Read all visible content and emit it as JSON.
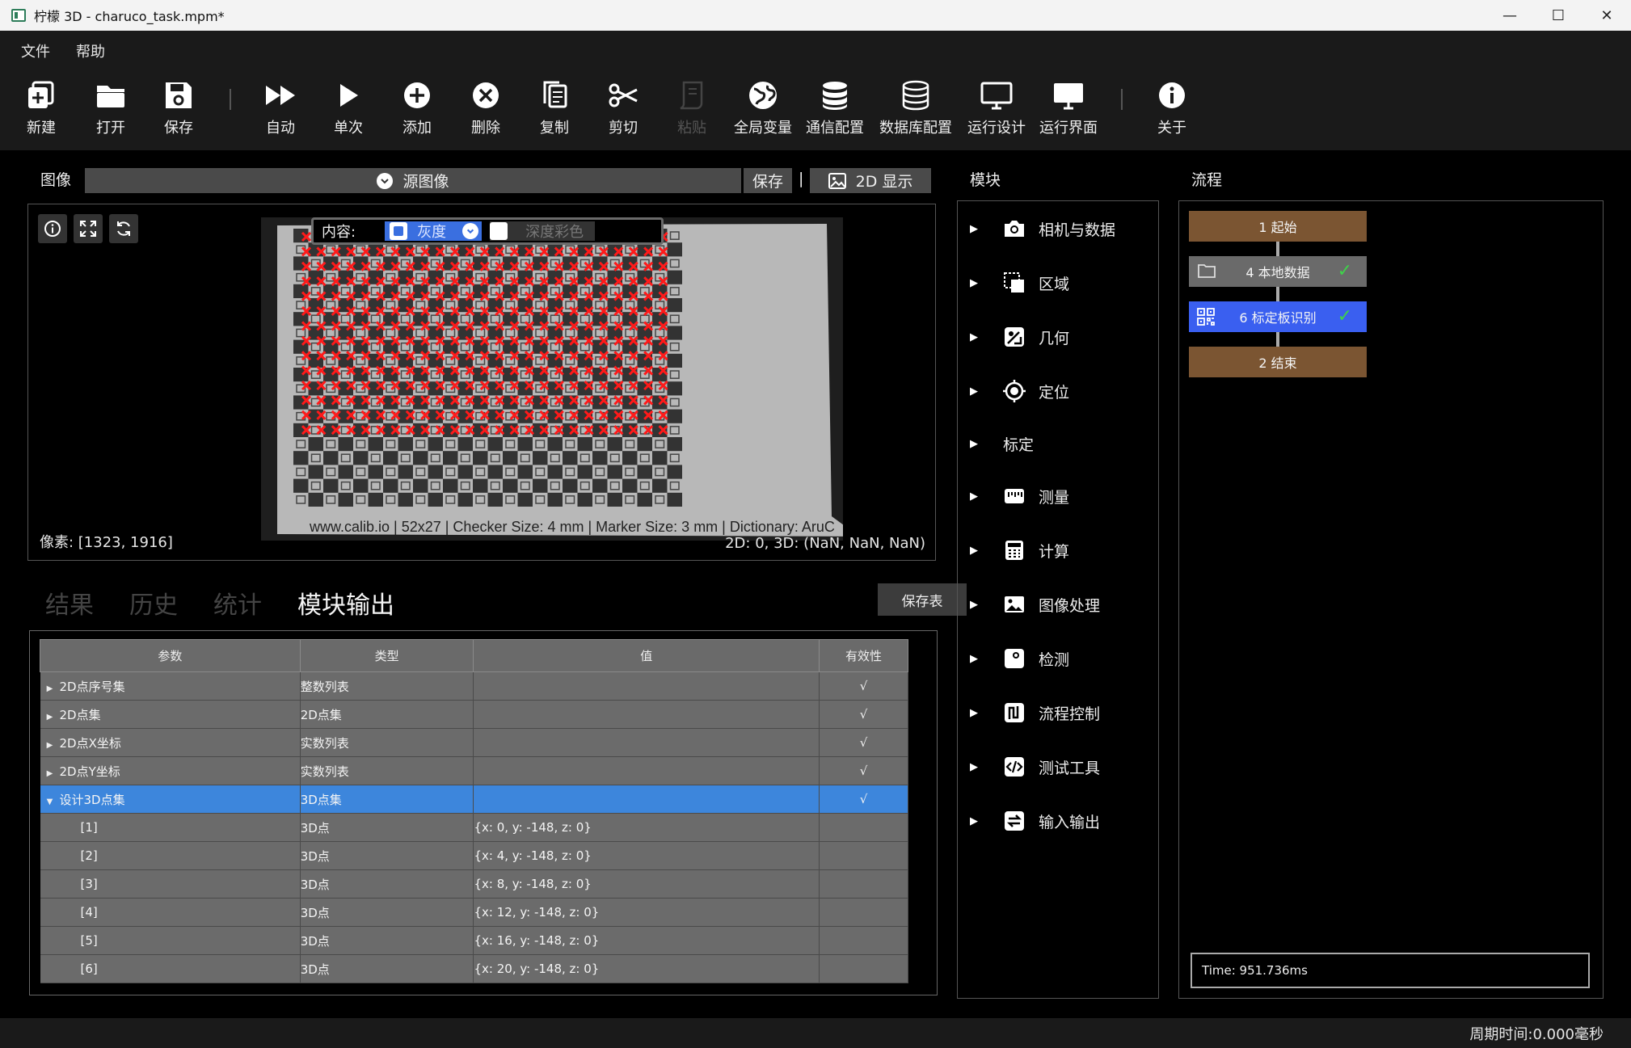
{
  "window": {
    "title": "柠檬 3D  - charuco_task.mpm*",
    "minimize": "—",
    "maximize": "☐",
    "close": "✕"
  },
  "menu": [
    "文件",
    "帮助"
  ],
  "toolbar": {
    "new": "新建",
    "open": "打开",
    "save": "保存",
    "auto": "自动",
    "single": "单次",
    "add": "添加",
    "delete": "删除",
    "copy": "复制",
    "cut": "剪切",
    "paste": "粘贴",
    "global_vars": "全局变量",
    "comm_config": "通信配置",
    "db_config": "数据库配置",
    "run_design": "运行设计",
    "run_ui": "运行界面",
    "about": "关于"
  },
  "image_panel": {
    "title": "图像",
    "source": "源图像",
    "save": "保存",
    "separator": "|",
    "display_mode": "2D 显示",
    "content_label": "内容:",
    "gray": "灰度",
    "depth_color": "深度彩色",
    "pixel_readout": "像素: [1323, 1916]",
    "coord_readout": "2D: 0, 3D: (NaN, NaN, NaN)",
    "photo_caption": "www.calib.io | 52x27 | Checker Size: 4 mm | Marker Size: 3 mm | Dictionary: AruC"
  },
  "tabs": {
    "results": "结果",
    "history": "历史",
    "stats": "统计",
    "module_output": "模块输出",
    "save_table": "保存表"
  },
  "table": {
    "headers": [
      "参数",
      "类型",
      "值",
      "有效性"
    ],
    "rows": [
      {
        "param": "2D点序号集",
        "type": "整数列表",
        "value": "",
        "valid": "√"
      },
      {
        "param": "2D点集",
        "type": "2D点集",
        "value": "",
        "valid": "√"
      },
      {
        "param": "2D点X坐标",
        "type": "实数列表",
        "value": "",
        "valid": "√"
      },
      {
        "param": "2D点Y坐标",
        "type": "实数列表",
        "value": "",
        "valid": "√"
      },
      {
        "param": "设计3D点集",
        "type": "3D点集",
        "value": "",
        "valid": "√"
      }
    ],
    "children": [
      {
        "param": "[1]",
        "type": "3D点",
        "value": "{x: 0, y: -148, z: 0}"
      },
      {
        "param": "[2]",
        "type": "3D点",
        "value": "{x: 4, y: -148, z: 0}"
      },
      {
        "param": "[3]",
        "type": "3D点",
        "value": "{x: 8, y: -148, z: 0}"
      },
      {
        "param": "[4]",
        "type": "3D点",
        "value": "{x: 12, y: -148, z: 0}"
      },
      {
        "param": "[5]",
        "type": "3D点",
        "value": "{x: 16, y: -148, z: 0}"
      },
      {
        "param": "[6]",
        "type": "3D点",
        "value": "{x: 20, y: -148, z: 0}"
      }
    ]
  },
  "modules": {
    "title": "模块",
    "items": [
      "相机与数据",
      "区域",
      "几何",
      "定位",
      "标定",
      "测量",
      "计算",
      "图像处理",
      "检测",
      "流程控制",
      "测试工具",
      "输入输出"
    ]
  },
  "flow": {
    "title": "流程",
    "nodes": [
      "1 起始",
      "4 本地数据",
      "6 标定板识别",
      "2 结束"
    ],
    "check": "✓",
    "time": "Time: 951.736ms"
  },
  "status": {
    "cycle_time": "周期时间:0.000毫秒"
  },
  "colors": {
    "accent_blue": "#3a5ff0",
    "selection_blue": "#3d86dc",
    "node_orange": "#7b5532",
    "marker_red": "#ff1a1a"
  }
}
